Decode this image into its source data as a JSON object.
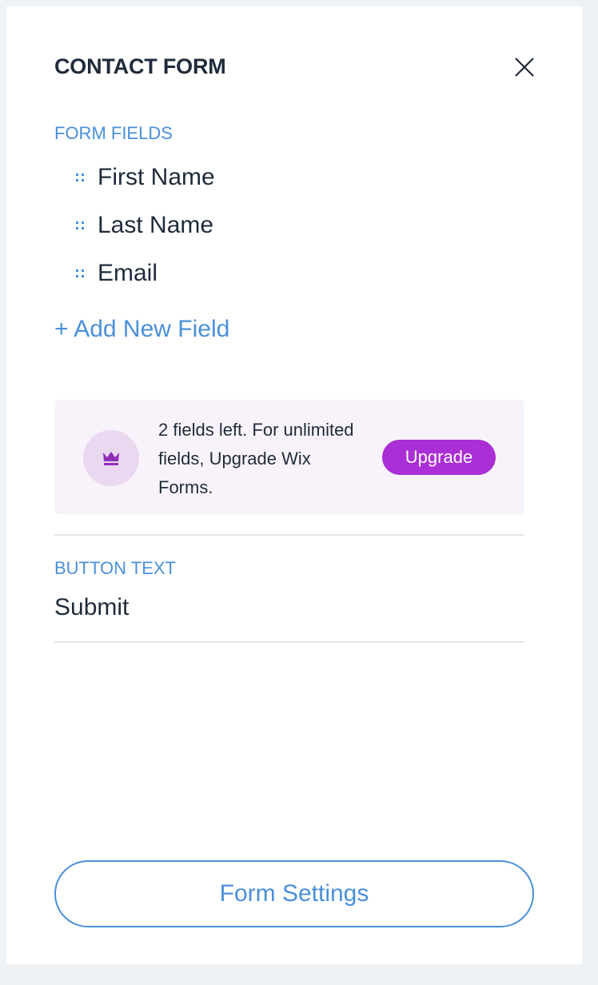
{
  "panel": {
    "title": "CONTACT FORM",
    "close_icon": "close-icon"
  },
  "form_fields": {
    "label": "FORM FIELDS",
    "items": [
      {
        "label": "First Name",
        "icon": "drag-handle-icon"
      },
      {
        "label": "Last Name",
        "icon": "drag-handle-icon"
      },
      {
        "label": "Email",
        "icon": "drag-handle-icon"
      }
    ],
    "add_label": "+ Add New Field"
  },
  "upgrade": {
    "icon": "crown-icon",
    "message": "2 fields left. For unlimited fields, Upgrade Wix Forms.",
    "button_label": "Upgrade"
  },
  "button_text": {
    "label": "BUTTON TEXT",
    "value": "Submit"
  },
  "footer": {
    "settings_label": "Form Settings"
  },
  "colors": {
    "accent": "#4a90d9",
    "upgrade_purple": "#aa2fd6",
    "text": "#1f2b3a",
    "upgrade_bg": "#f8f3fa"
  }
}
